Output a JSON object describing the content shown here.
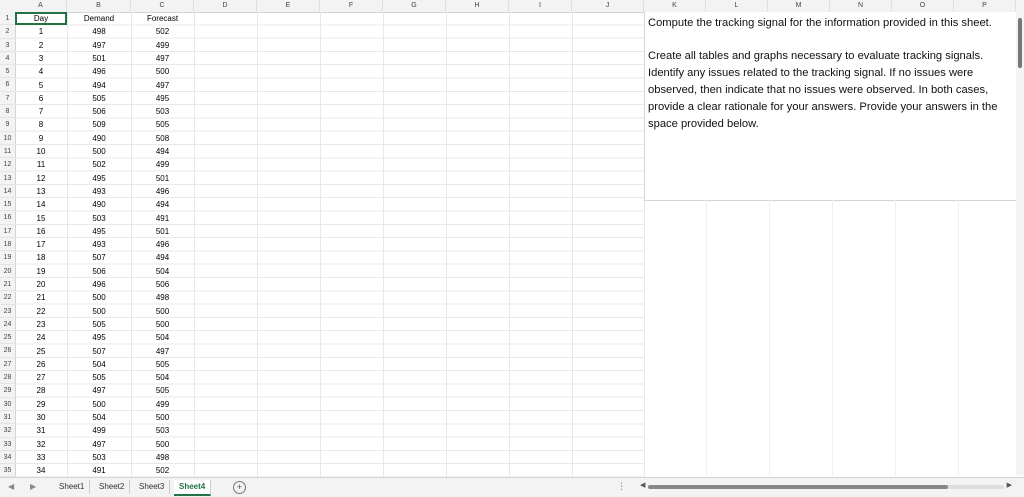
{
  "columns": [
    "A",
    "B",
    "C",
    "D",
    "E",
    "F",
    "G",
    "H",
    "I",
    "J",
    "K",
    "L",
    "M",
    "N",
    "O",
    "P"
  ],
  "row_numbers": [
    "1",
    "2",
    "3",
    "4",
    "5",
    "6",
    "7",
    "8",
    "9",
    "10",
    "11",
    "12",
    "13",
    "14",
    "15",
    "16",
    "17",
    "18",
    "19",
    "20",
    "21",
    "22",
    "23",
    "24",
    "25",
    "26",
    "27",
    "28",
    "29",
    "30",
    "31",
    "32",
    "33",
    "34",
    "35"
  ],
  "header": {
    "day": "Day",
    "demand": "Demand",
    "forecast": "Forecast"
  },
  "rows": [
    [
      "1",
      "498",
      "502"
    ],
    [
      "2",
      "497",
      "499"
    ],
    [
      "3",
      "501",
      "497"
    ],
    [
      "4",
      "496",
      "500"
    ],
    [
      "5",
      "494",
      "497"
    ],
    [
      "6",
      "505",
      "495"
    ],
    [
      "7",
      "506",
      "503"
    ],
    [
      "8",
      "509",
      "505"
    ],
    [
      "9",
      "490",
      "508"
    ],
    [
      "10",
      "500",
      "494"
    ],
    [
      "11",
      "502",
      "499"
    ],
    [
      "12",
      "495",
      "501"
    ],
    [
      "13",
      "493",
      "496"
    ],
    [
      "14",
      "490",
      "494"
    ],
    [
      "15",
      "503",
      "491"
    ],
    [
      "16",
      "495",
      "501"
    ],
    [
      "17",
      "493",
      "496"
    ],
    [
      "18",
      "507",
      "494"
    ],
    [
      "19",
      "506",
      "504"
    ],
    [
      "20",
      "496",
      "506"
    ],
    [
      "21",
      "500",
      "498"
    ],
    [
      "22",
      "500",
      "500"
    ],
    [
      "23",
      "505",
      "500"
    ],
    [
      "24",
      "495",
      "504"
    ],
    [
      "25",
      "507",
      "497"
    ],
    [
      "26",
      "504",
      "505"
    ],
    [
      "27",
      "505",
      "504"
    ],
    [
      "28",
      "497",
      "505"
    ],
    [
      "29",
      "500",
      "499"
    ],
    [
      "30",
      "504",
      "500"
    ],
    [
      "31",
      "499",
      "503"
    ],
    [
      "32",
      "497",
      "500"
    ],
    [
      "33",
      "503",
      "498"
    ],
    [
      "34",
      "491",
      "502"
    ]
  ],
  "instructions": {
    "line1": "Compute the tracking signal for the information provided in this sheet.",
    "line2": "Create all tables and graphs necessary to evaluate tracking signals. Identify any issues related to the tracking signal. If no issues were observed, then indicate that no issues were observed. In both cases, provide a clear rationale for your answers. Provide your answers in the space provided below."
  },
  "tabs": [
    "Sheet1",
    "Sheet2",
    "Sheet3",
    "Sheet4"
  ],
  "active_tab": "Sheet4",
  "add_sheet_label": "+",
  "nav_left": "◀",
  "nav_right": "▶",
  "more_label": "⋮",
  "accent_color": "#217346"
}
